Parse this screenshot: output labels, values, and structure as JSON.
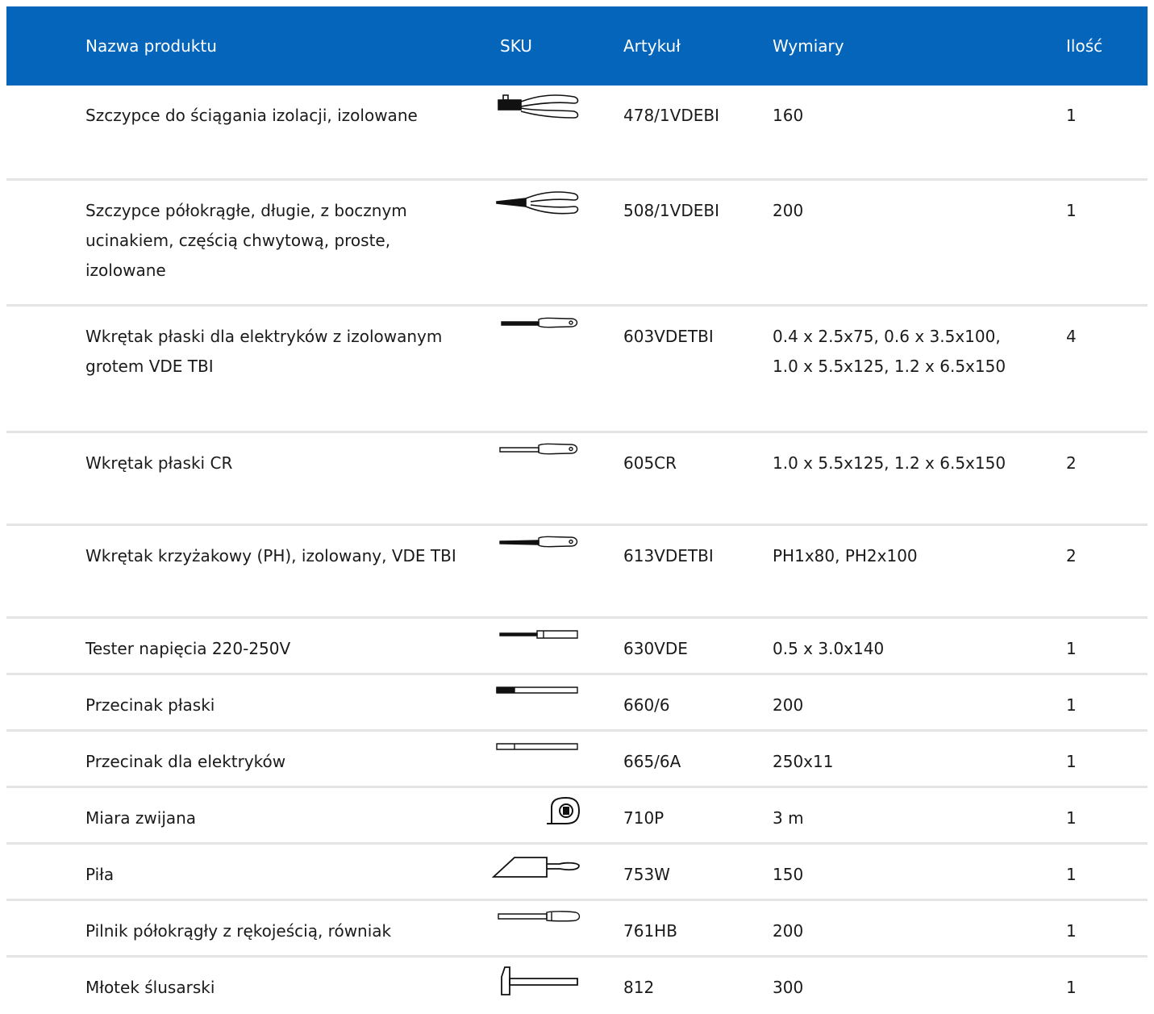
{
  "header": {
    "name": "Nazwa produktu",
    "sku": "SKU",
    "article": "Artykuł",
    "dimensions": "Wymiary",
    "qty": "Ilość"
  },
  "colors": {
    "header_bg": "#0565ba",
    "header_text": "#ffffff",
    "divider": "#e4e4e4"
  },
  "rows": [
    {
      "name": "Szczypce do ściągania izolacji, izolowane",
      "icon": "wire-stripper-icon",
      "article": "478/1VDEBI",
      "dimensions": "160",
      "qty": "1"
    },
    {
      "name": "Szczypce półokrągłe, długie, z bocznym ucinakiem, częścią chwytową, proste, izolowane",
      "icon": "long-nose-pliers-icon",
      "article": "508/1VDEBI",
      "dimensions": "200",
      "qty": "1"
    },
    {
      "name": "Wkrętak płaski dla elektryków z izolowanym grotem VDE TBI",
      "icon": "screwdriver-icon",
      "article": "603VDETBI",
      "dimensions": "0.4 x 2.5x75, 0.6 x 3.5x100, 1.0 x 5.5x125, 1.2 x 6.5x150",
      "qty": "4"
    },
    {
      "name": "Wkrętak płaski CR",
      "icon": "screwdriver-icon",
      "article": "605CR",
      "dimensions": "1.0 x 5.5x125, 1.2 x 6.5x150",
      "qty": "2"
    },
    {
      "name": "Wkrętak krzyżakowy (PH), izolowany, VDE TBI",
      "icon": "phillips-screwdriver-icon",
      "article": "613VDETBI",
      "dimensions": "PH1x80, PH2x100",
      "qty": "2"
    },
    {
      "name": "Tester napięcia 220-250V",
      "icon": "voltage-tester-icon",
      "article": "630VDE",
      "dimensions": "0.5 x 3.0x140",
      "qty": "1"
    },
    {
      "name": "Przecinak płaski",
      "icon": "flat-chisel-icon",
      "article": "660/6",
      "dimensions": "200",
      "qty": "1"
    },
    {
      "name": "Przecinak dla elektryków",
      "icon": "electrician-chisel-icon",
      "article": "665/6A",
      "dimensions": "250x11",
      "qty": "1"
    },
    {
      "name": "Miara zwijana",
      "icon": "tape-measure-icon",
      "article": "710P",
      "dimensions": "3 m",
      "qty": "1"
    },
    {
      "name": "Piła",
      "icon": "saw-icon",
      "article": "753W",
      "dimensions": "150",
      "qty": "1"
    },
    {
      "name": "Pilnik półokrągły z rękojeścią, równiak",
      "icon": "file-icon",
      "article": "761HB",
      "dimensions": "200",
      "qty": "1"
    },
    {
      "name": "Młotek ślusarski",
      "icon": "hammer-icon",
      "article": "812",
      "dimensions": "300",
      "qty": "1"
    }
  ]
}
